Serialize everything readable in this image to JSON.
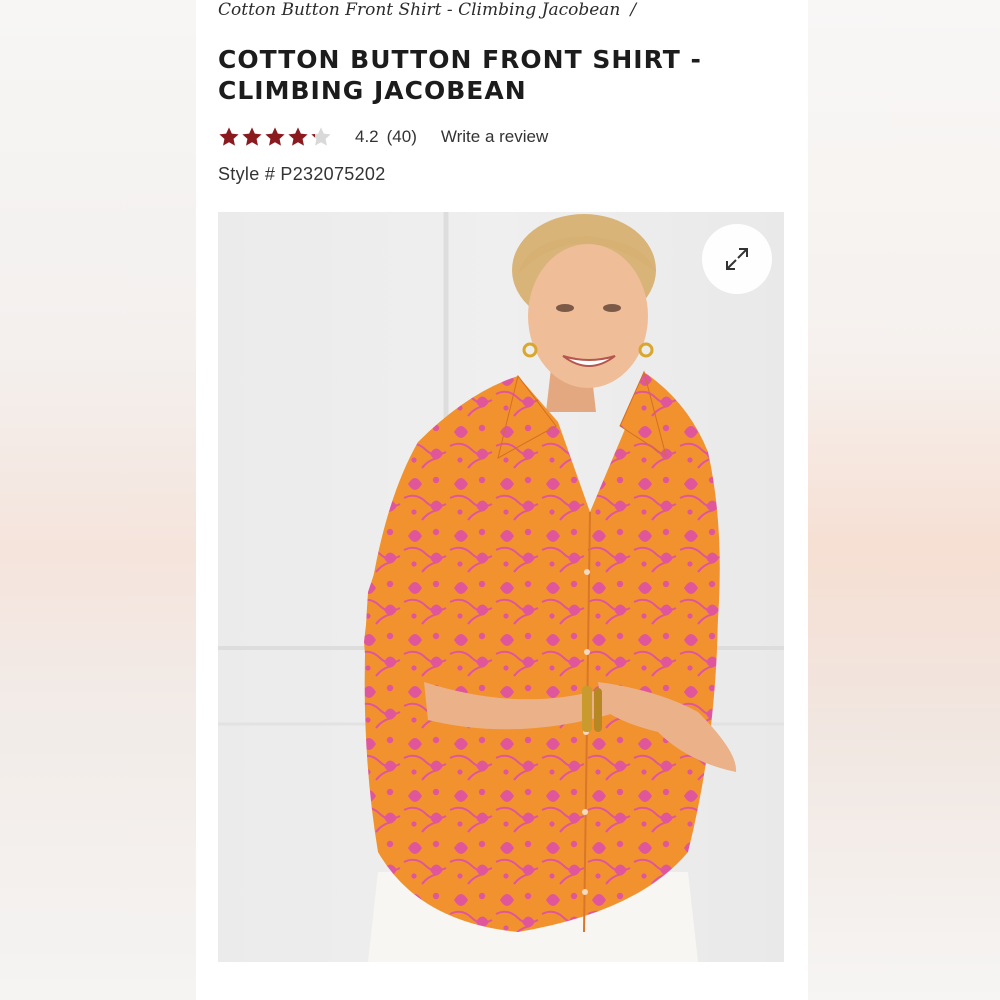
{
  "breadcrumb": {
    "current": "Cotton Button Front Shirt - Climbing Jacobean",
    "separator": "/"
  },
  "product": {
    "title": "COTTON BUTTON FRONT SHIRT - CLIMBING JACOBEAN",
    "rating": {
      "stars_value": 4.2,
      "stars_max": 5,
      "value_text": "4.2",
      "count_text": "(40)",
      "write_review_label": "Write a review",
      "star_color": "#8b1a1f",
      "empty_star_color": "#d9d9d9"
    },
    "style_text": "Style # P232075202"
  },
  "image": {
    "expand_icon": "expand-arrows-icon",
    "shirt_color": "#f2922e",
    "print_color": "#e0569b"
  }
}
